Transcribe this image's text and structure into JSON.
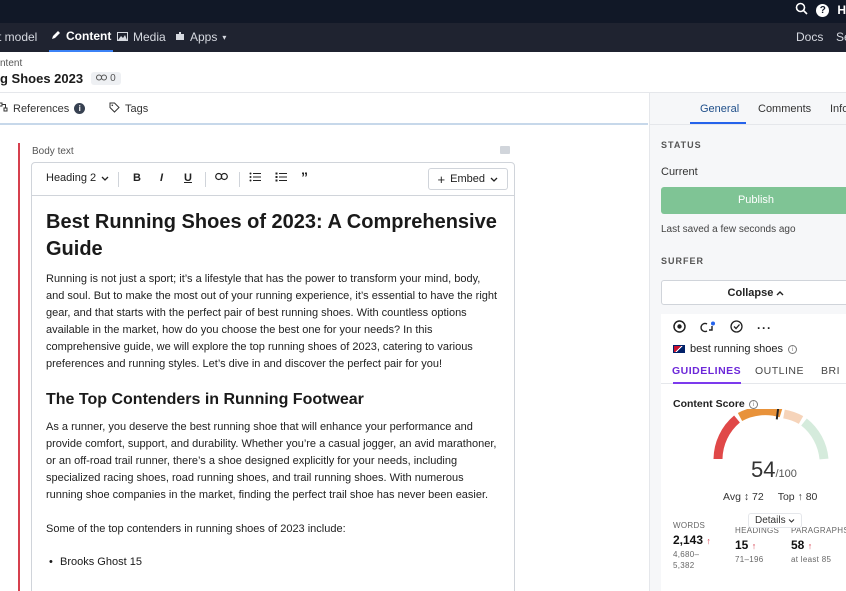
{
  "topbar": {
    "search_icon": "search-icon",
    "help_icon": "help-icon",
    "help_text": "H"
  },
  "nav": {
    "items": [
      {
        "label": "t model",
        "icon": ""
      },
      {
        "label": "Content",
        "icon": "pen-icon",
        "active": true
      },
      {
        "label": "Media",
        "icon": "image-icon"
      },
      {
        "label": "Apps",
        "icon": "puzzle-icon"
      }
    ],
    "right": {
      "docs": "Docs",
      "se": "Se"
    }
  },
  "header": {
    "breadcrumb": "ntent",
    "title": "g Shoes 2023",
    "link_count": "0"
  },
  "left_tabs": {
    "references": "References",
    "tags": "Tags"
  },
  "editor": {
    "field_label": "Body text",
    "toolbar": {
      "heading": "Heading 2",
      "bold": "B",
      "italic": "I",
      "underline": "U",
      "quote": "”",
      "embed": "Embed"
    },
    "h1": "Best Running Shoes of 2023: A Comprehensive Guide",
    "p1": "Running is not just a sport; it’s a lifestyle that has the power to transform your mind, body, and soul. But to make the most out of your running experience, it’s essential to have the right gear, and that starts with the perfect pair of best running shoes. With countless options available in the market, how do you choose the best one for your needs? In this comprehensive guide, we will explore the top running shoes of 2023, catering to various preferences and running styles. Let’s dive in and discover the perfect pair for you!",
    "h2": "The Top Contenders in Running Footwear",
    "p2": "As a runner, you deserve the best running shoe that will enhance your performance and provide comfort, support, and durability. Whether you’re a casual jogger, an avid marathoner, or an off-road trail runner, there’s a shoe designed explicitly for your needs, including specialized racing shoes, road running shoes, and trail running shoes. With numerous running shoe companies in the market, finding the perfect trail shoe has never been easier.",
    "p3": "Some of the top contenders in running shoes of 2023 include:",
    "li1": "Brooks Ghost 15"
  },
  "right_panel": {
    "tabs": {
      "general": "General",
      "comments": "Comments",
      "info": "Info"
    },
    "status_title": "STATUS",
    "status_value": "Current",
    "publish": "Publish",
    "last_saved": "Last saved a few seconds ago",
    "surfer_title": "SURFER",
    "collapse": "Collapse",
    "surfer": {
      "keyword": "best running shoes",
      "tabs": {
        "guidelines": "GUIDELINES",
        "outline": "OUTLINE",
        "brief": "BRI"
      },
      "content_score_label": "Content Score",
      "score": "54",
      "score_max": "/100",
      "score_value": 54,
      "avg_label": "Avg",
      "avg": "72",
      "top_label": "Top",
      "top": "80",
      "details": "Details",
      "stats": [
        {
          "label": "WORDS",
          "value": "2,143",
          "range": "4,680–\n5,382"
        },
        {
          "label": "HEADINGS",
          "value": "15",
          "range": "71–196"
        },
        {
          "label": "PARAGRAPHS",
          "value": "58",
          "range": "at least 85"
        }
      ]
    }
  }
}
